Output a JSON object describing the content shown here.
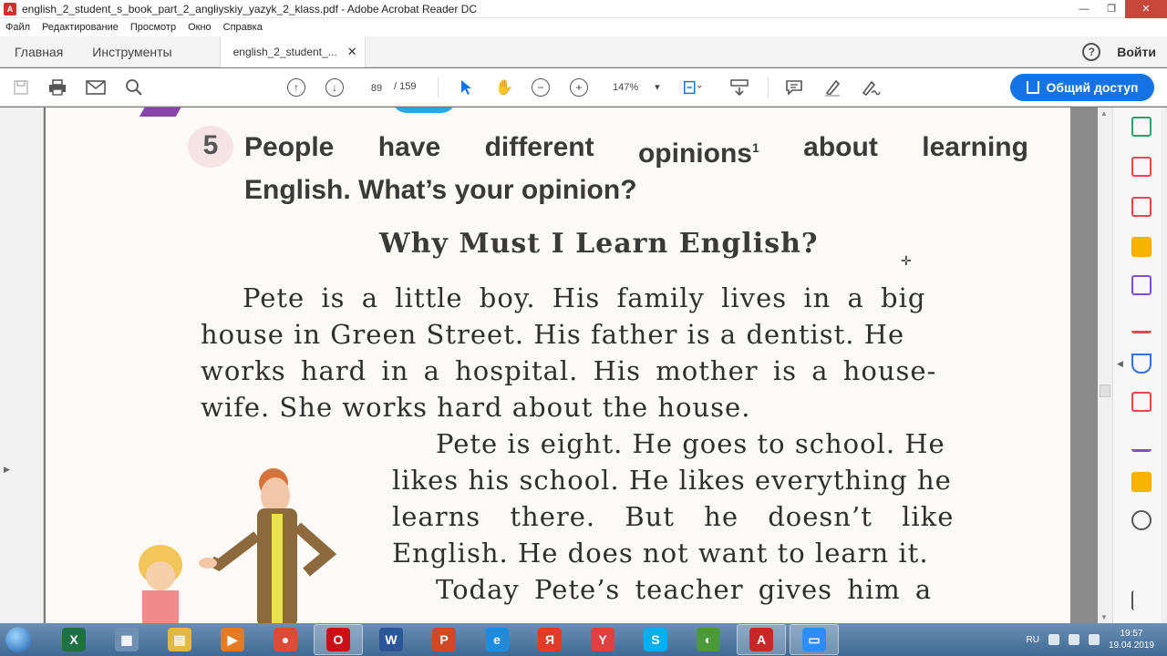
{
  "window": {
    "title": "english_2_student_s_book_part_2_angliyskiy_yazyk_2_klass.pdf - Adobe Acrobat Reader DC"
  },
  "menu": [
    "Файл",
    "Редактирование",
    "Просмотр",
    "Окно",
    "Справка"
  ],
  "tabs": {
    "home": "Главная",
    "tools": "Инструменты",
    "doc": "english_2_student_...",
    "signin": "Войти"
  },
  "toolbar": {
    "page_current": "89",
    "page_total": "/ 159",
    "zoom": "147%",
    "share_label": "Общий доступ"
  },
  "document": {
    "exercise_number": "5",
    "heading_words": [
      "People",
      "have",
      "different",
      "opinions",
      "about",
      "learning"
    ],
    "heading_footnote": "1",
    "heading_line2": "English. What’s your opinion?",
    "subtitle": "Why Must I Learn English?",
    "lines": [
      "Pete is a little boy. His family lives in a big",
      "house in Green Street. His father is a dentist. He",
      "works hard in a hospital. His mother is a house-",
      "wife. She works hard about the house.",
      "Pete is eight. He goes to school. He",
      "likes his school. He likes everything he",
      "learns there. But he doesn’t like",
      "English. He does not want to learn it.",
      "Today Pete’s teacher gives him a"
    ]
  },
  "taskbar": {
    "apps": [
      {
        "name": "excel",
        "glyph": "X",
        "color": "#1e7145"
      },
      {
        "name": "calculator",
        "glyph": "▦",
        "color": "#6f8fb0"
      },
      {
        "name": "explorer",
        "glyph": "▤",
        "color": "#e0b84a"
      },
      {
        "name": "media-player",
        "glyph": "▶",
        "color": "#e27b22"
      },
      {
        "name": "chrome",
        "glyph": "●",
        "color": "#dd4b39"
      },
      {
        "name": "opera",
        "glyph": "O",
        "color": "#cc0f16"
      },
      {
        "name": "word",
        "glyph": "W",
        "color": "#2b579a"
      },
      {
        "name": "powerpoint",
        "glyph": "P",
        "color": "#d24726"
      },
      {
        "name": "internet-explorer",
        "glyph": "e",
        "color": "#1d8ce0"
      },
      {
        "name": "yandex",
        "glyph": "Я",
        "color": "#e23b2a"
      },
      {
        "name": "yandex-browser",
        "glyph": "Y",
        "color": "#e04040"
      },
      {
        "name": "skype",
        "glyph": "S",
        "color": "#00aff0"
      },
      {
        "name": "maps",
        "glyph": "◐",
        "color": "#4a9a3a"
      },
      {
        "name": "acrobat",
        "glyph": "A",
        "color": "#c62828"
      },
      {
        "name": "zoom",
        "glyph": "▭",
        "color": "#2d8cff"
      }
    ],
    "lang": "RU",
    "time": "19:57",
    "date": "19.04.2019"
  }
}
